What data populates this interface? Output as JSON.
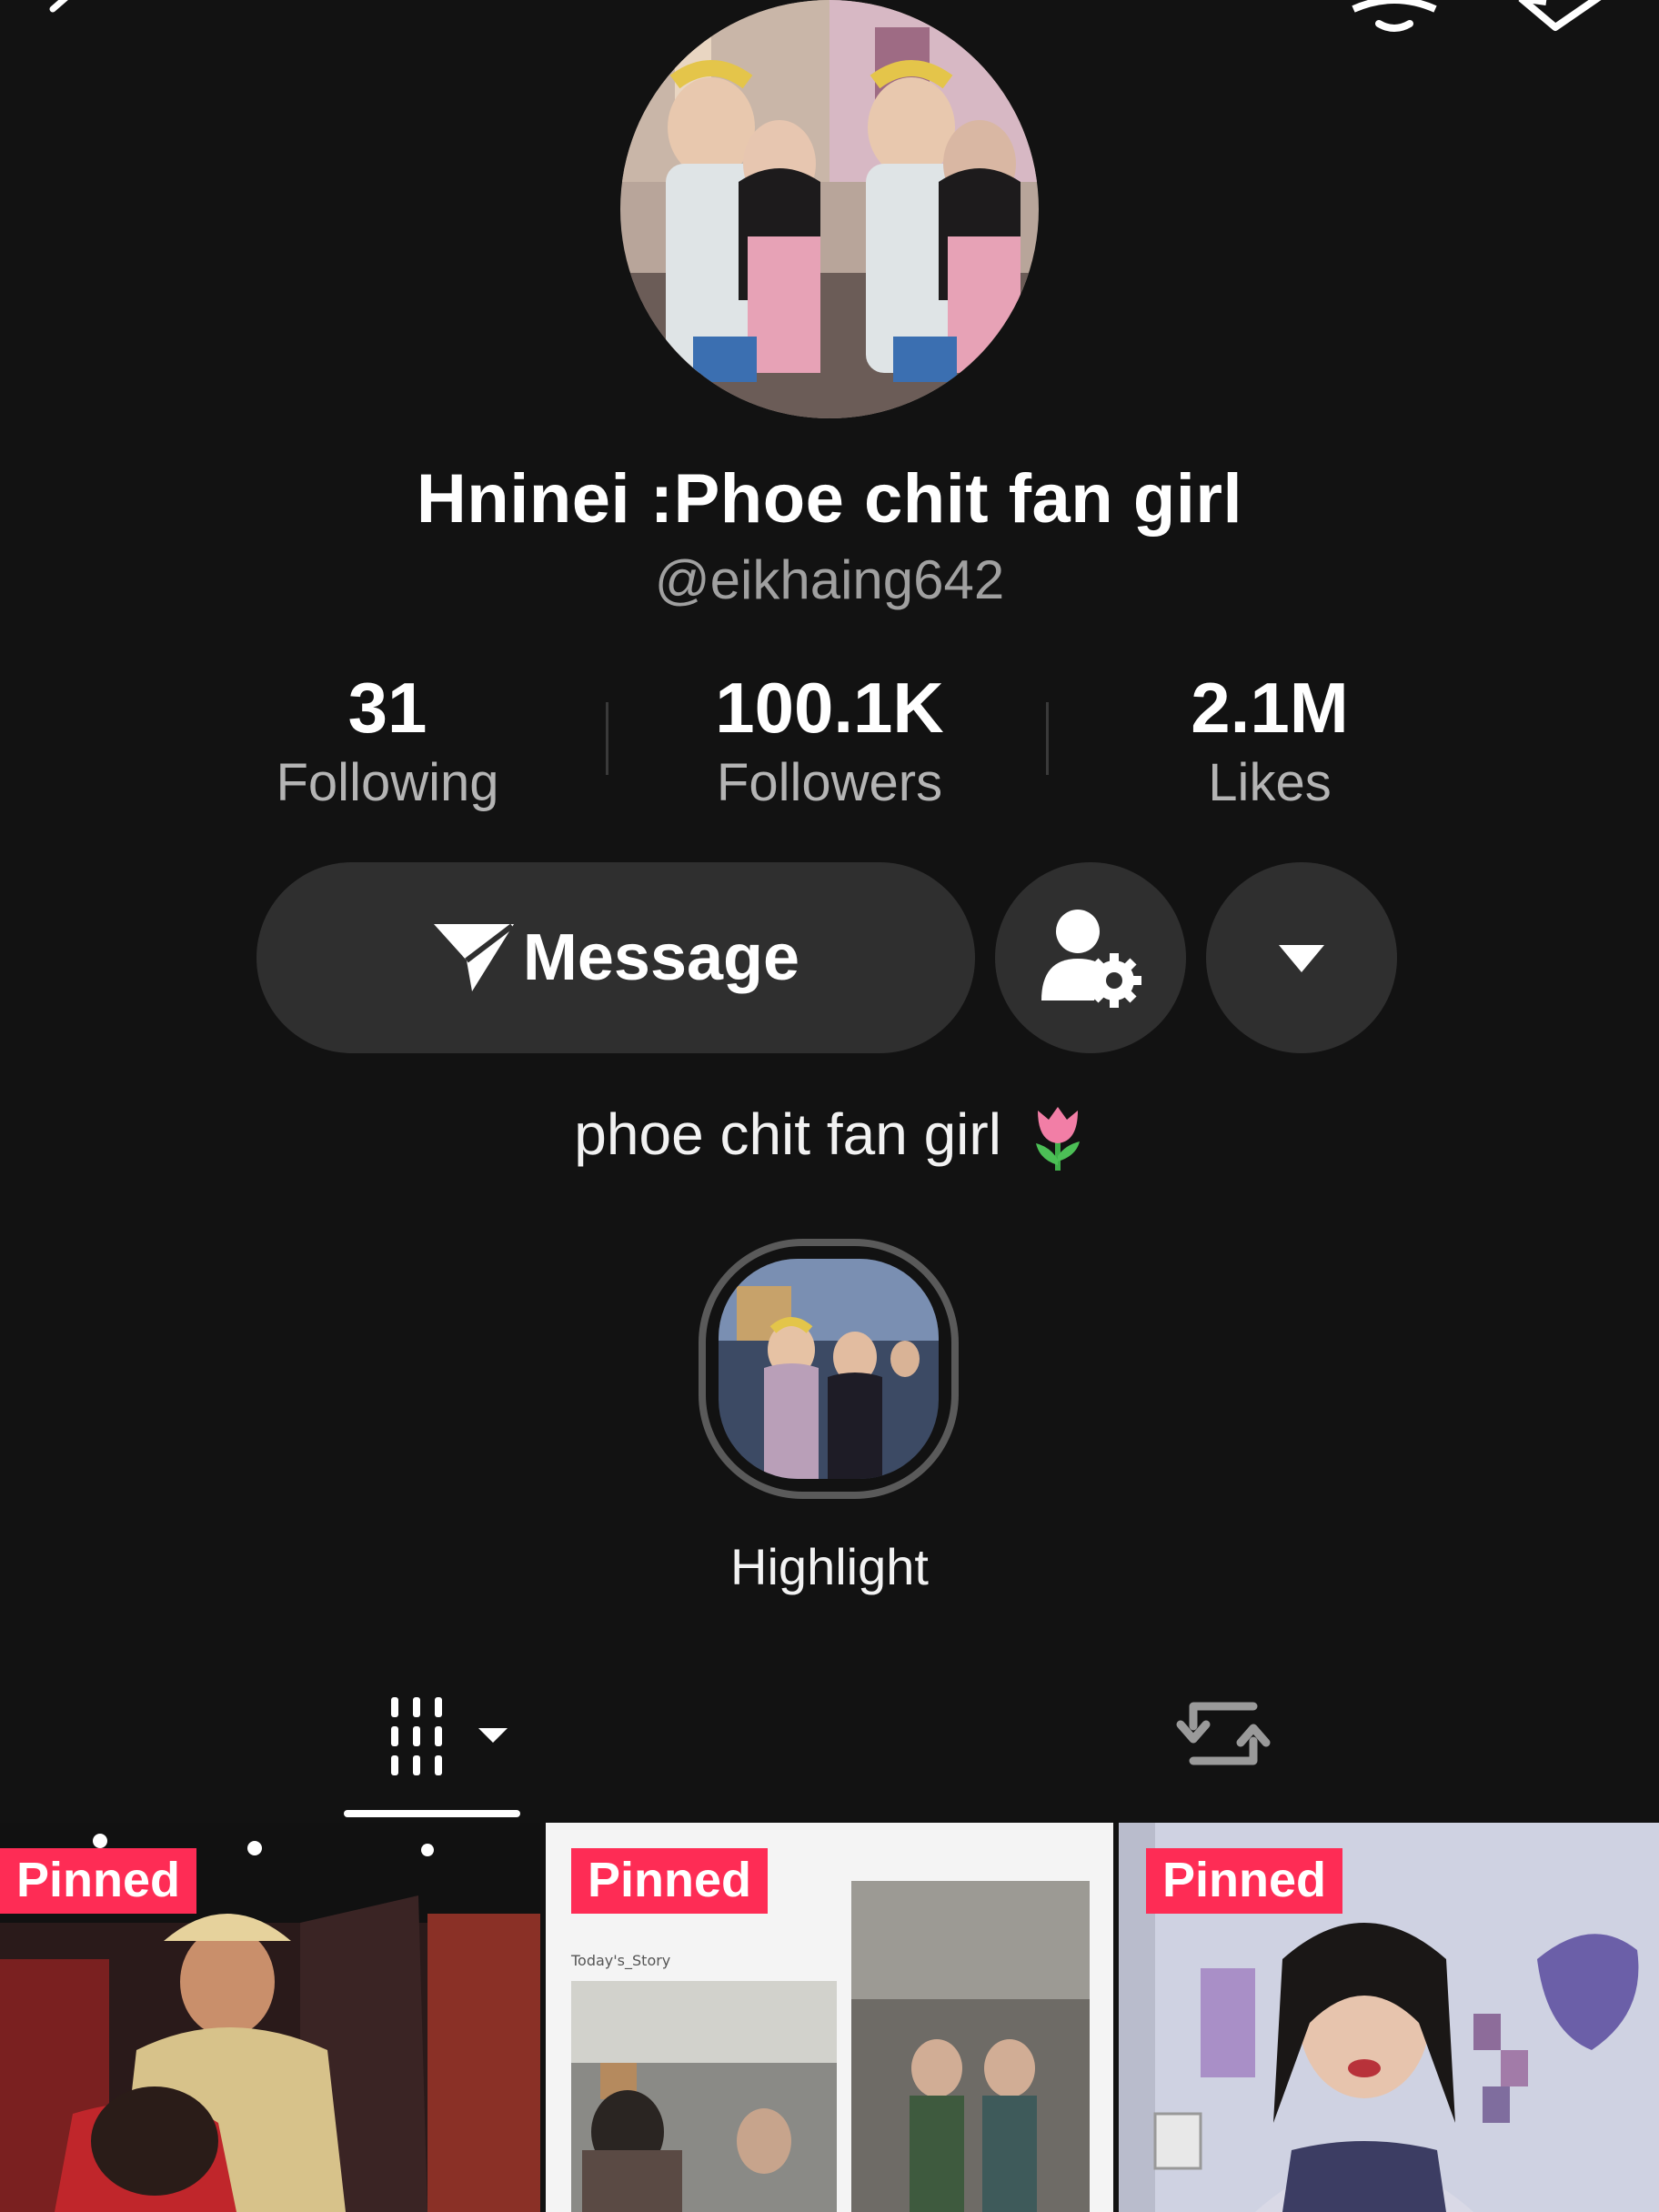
{
  "profile": {
    "display_name": "Hninei :Phoe chit fan girl",
    "handle": "@eikhaing642",
    "bio": "phoe chit fan girl"
  },
  "stats": {
    "following": {
      "value": "31",
      "label": "Following"
    },
    "followers": {
      "value": "100.1K",
      "label": "Followers"
    },
    "likes": {
      "value": "2.1M",
      "label": "Likes"
    }
  },
  "actions": {
    "message_label": "Message"
  },
  "highlight": {
    "label": "Highlight"
  },
  "tabs": [
    {
      "name": "videos",
      "icon": "grid-dropdown-icon",
      "selected": true
    },
    {
      "name": "reposts",
      "icon": "repost-icon",
      "selected": false
    }
  ],
  "videos": [
    {
      "badge": "Pinned"
    },
    {
      "badge": "Pinned",
      "caption": "Today's_Story"
    },
    {
      "badge": "Pinned"
    }
  ],
  "colors": {
    "background": "#121212",
    "button": "#2f2f2f",
    "pinned": "#fe2c55",
    "secondary_text": "#a0a0a0"
  }
}
